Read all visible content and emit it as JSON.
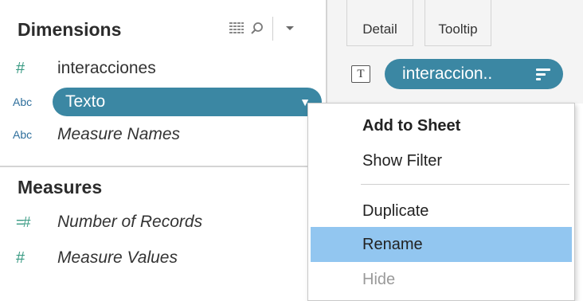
{
  "data_pane": {
    "dimensions_title": "Dimensions",
    "measures_title": "Measures",
    "header_icons": [
      "grid-view-icon",
      "search-icon",
      "chevron-down-icon"
    ],
    "dimensions": [
      {
        "type_icon": "#",
        "name": "interacciones",
        "italic": false
      },
      {
        "type_icon": "Abc",
        "name": "Texto",
        "selected": true
      },
      {
        "type_icon": "Abc",
        "name": "Measure Names",
        "italic": true
      }
    ],
    "measures": [
      {
        "type_icon": "=#",
        "name": "Number of Records",
        "italic": true
      },
      {
        "type_icon": "#",
        "name": "Measure Values",
        "italic": true
      }
    ],
    "selected_caret": "▼"
  },
  "marks": {
    "detail_label": "Detail",
    "tooltip_label": "Tooltip",
    "text_mark_icon": "T",
    "text_pill_label": "interaccion..",
    "pill_color": "#3b87a3"
  },
  "context_menu": {
    "items": [
      {
        "label": "Add to Sheet",
        "bold": true
      },
      {
        "label": "Show Filter"
      },
      {
        "label": "Duplicate"
      },
      {
        "label": "Rename",
        "highlighted": true
      },
      {
        "label": "Hide",
        "disabled": true
      }
    ],
    "highlight_color": "#92c6f0"
  }
}
